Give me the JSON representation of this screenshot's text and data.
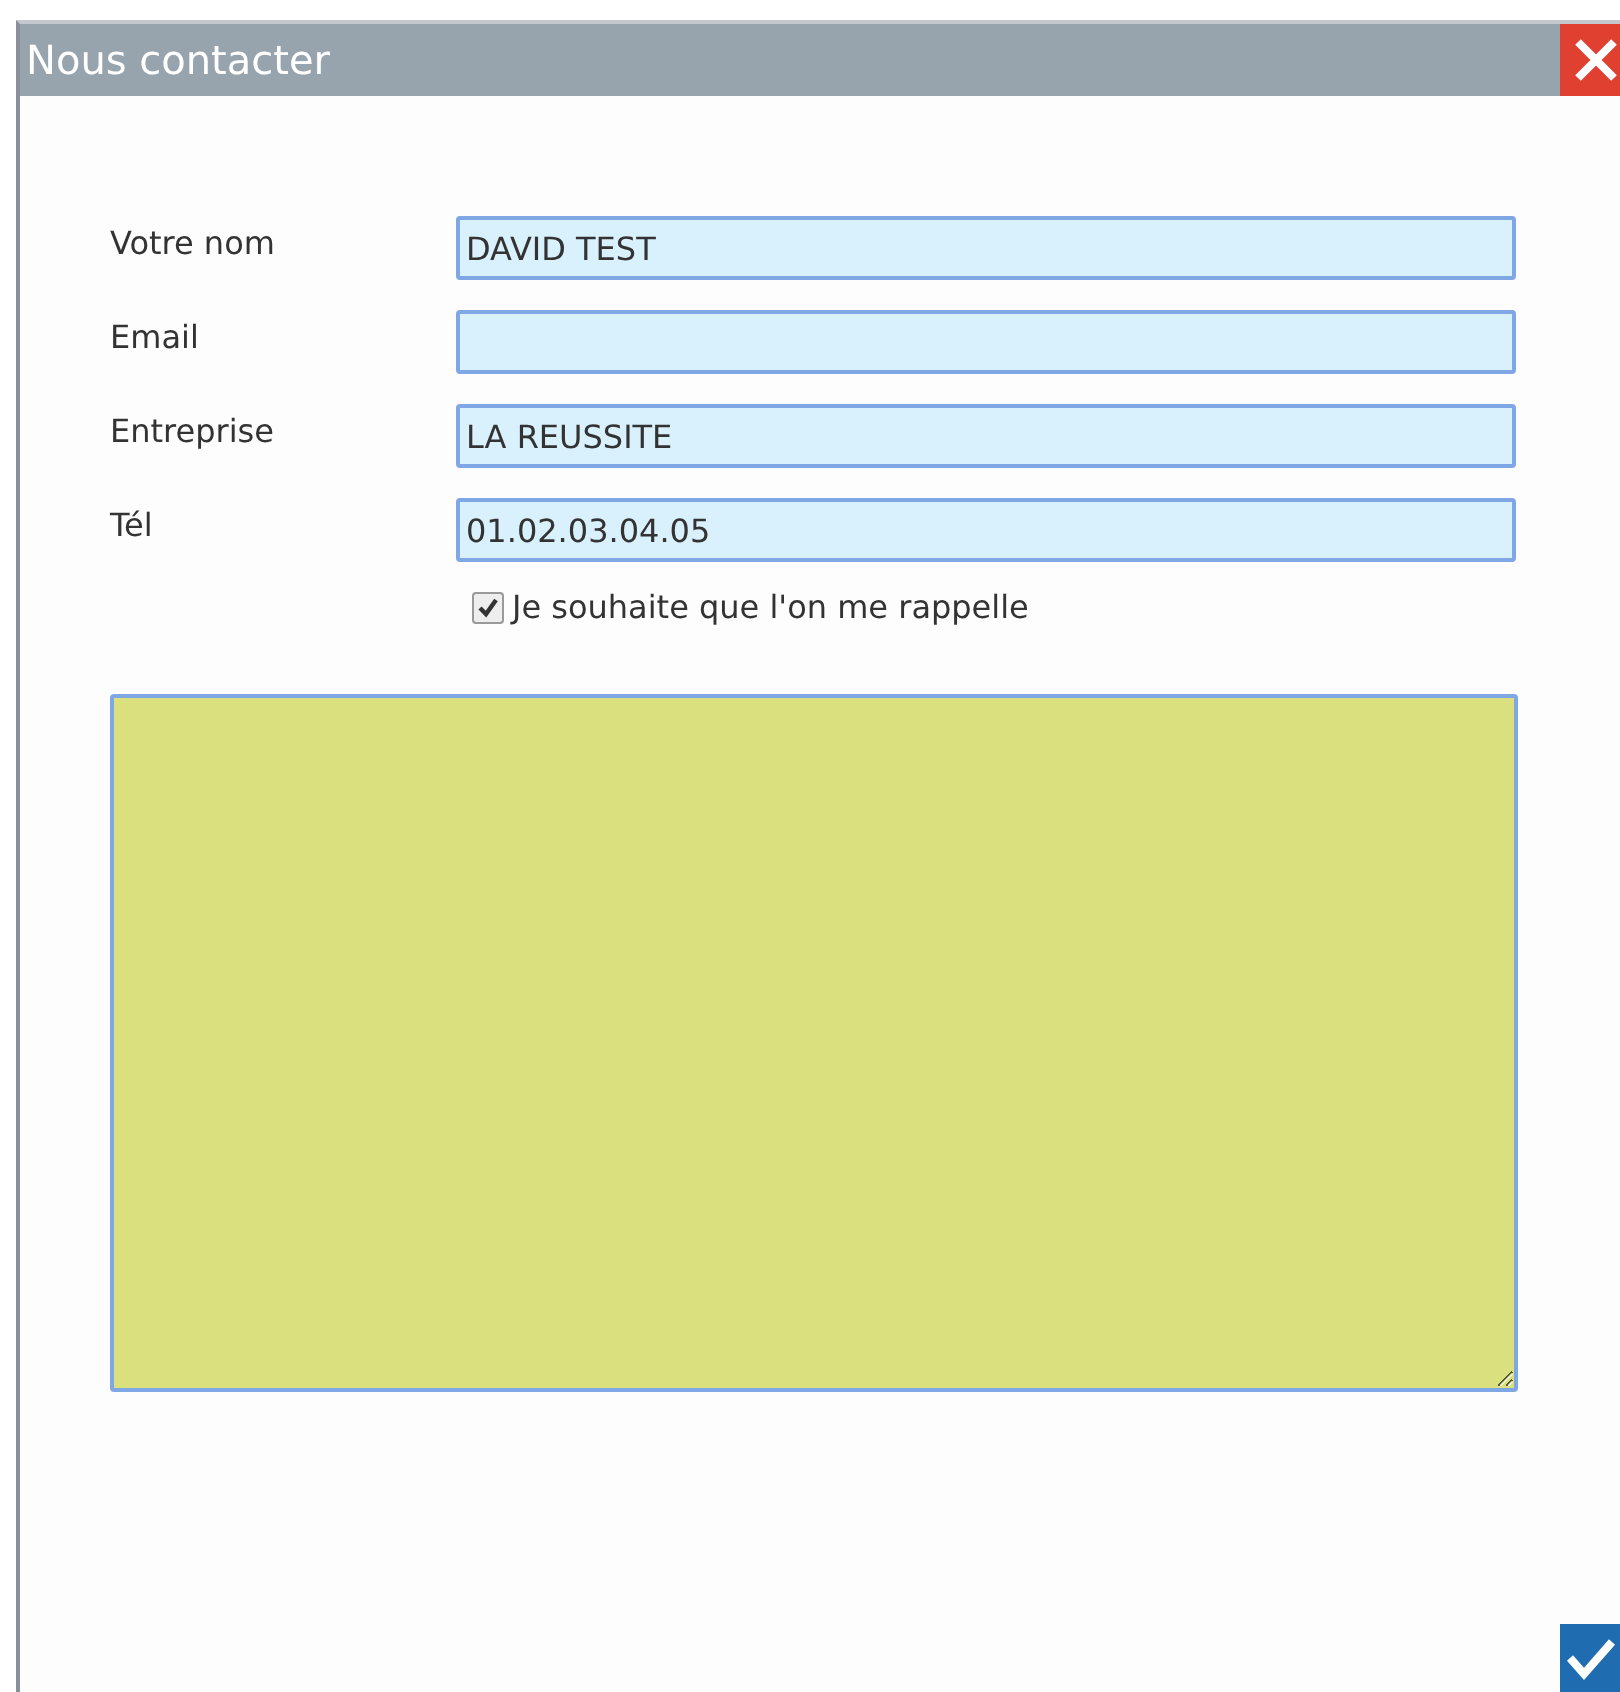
{
  "window": {
    "title": "Nous contacter"
  },
  "fields": [
    {
      "label": "Votre nom",
      "value": "DAVID TEST"
    },
    {
      "label": "Email"
    },
    {
      "label": "Entreprise",
      "value": "LA REUSSITE"
    },
    {
      "label": "Tél",
      "value": "01.02.03.04.05"
    }
  ],
  "callback": {
    "label": "Je souhaite que l'on me rappelle",
    "checked": true
  }
}
